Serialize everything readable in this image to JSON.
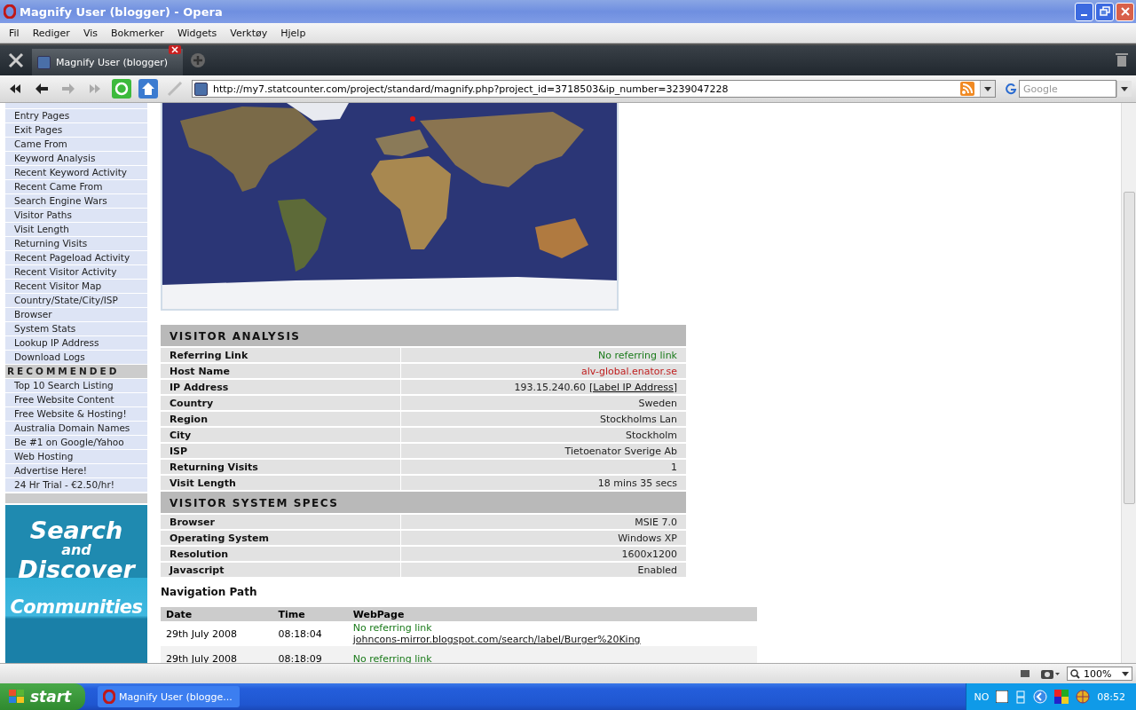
{
  "window": {
    "title": "Magnify User (blogger) - Opera"
  },
  "menu": [
    "Fil",
    "Rediger",
    "Vis",
    "Bokmerker",
    "Widgets",
    "Verktøy",
    "Hjelp"
  ],
  "tabs": [
    {
      "label": "Magnify User (blogger)",
      "selected": true
    }
  ],
  "address": {
    "url": "http://my7.statcounter.com/project/standard/magnify.php?project_id=3718503&ip_number=3239047228"
  },
  "search": {
    "placeholder": "Google"
  },
  "sidebar": {
    "items": [
      "Entry Pages",
      "Exit Pages",
      "Came From",
      "Keyword Analysis",
      "Recent Keyword Activity",
      "Recent Came From",
      "Search Engine Wars",
      "Visitor Paths",
      "Visit Length",
      "Returning Visits",
      "Recent Pageload Activity",
      "Recent Visitor Activity",
      "Recent Visitor Map",
      "Country/State/City/ISP",
      "Browser",
      "System Stats",
      "Lookup IP Address",
      "Download Logs"
    ],
    "section": "RECOMMENDED",
    "recommended": [
      "Top 10 Search Listing",
      "Free Website Content",
      "Free Website & Hosting!",
      "Australia Domain Names",
      "Be #1 on Google/Yahoo",
      "Web Hosting",
      "Advertise Here!",
      "24 Hr Trial - €2.50/hr!"
    ],
    "banner": {
      "line1": "Search",
      "line2": "and",
      "line3": "Discover",
      "line4": "Communities"
    }
  },
  "map": {
    "kind": "picture"
  },
  "sections": [
    {
      "title": "VISITOR ANALYSIS",
      "rows": [
        {
          "label": "Referring Link",
          "value": "No referring link",
          "kind": "referrer"
        },
        {
          "label": "Host Name",
          "value": "alv-global.enator.se",
          "kind": "host"
        },
        {
          "label": "IP Address",
          "value": "193.15.240.60",
          "link": "[Label IP Address]",
          "kind": "ip"
        },
        {
          "label": "Country",
          "value": "Sweden",
          "kind": "plain"
        },
        {
          "label": "Region",
          "value": "Stockholms Lan",
          "kind": "plain"
        },
        {
          "label": "City",
          "value": "Stockholm",
          "kind": "plain"
        },
        {
          "label": "ISP",
          "value": "Tietoenator Sverige Ab",
          "kind": "plain"
        },
        {
          "label": "Returning Visits",
          "value": "1",
          "kind": "plain"
        },
        {
          "label": "Visit Length",
          "value": "18 mins 35 secs",
          "kind": "plain"
        }
      ]
    },
    {
      "title": "VISITOR SYSTEM SPECS",
      "rows": [
        {
          "label": "Browser",
          "value": "MSIE 7.0",
          "kind": "plain"
        },
        {
          "label": "Operating System",
          "value": "Windows XP",
          "kind": "plain"
        },
        {
          "label": "Resolution",
          "value": "1600x1200",
          "kind": "plain"
        },
        {
          "label": "Javascript",
          "value": "Enabled",
          "kind": "plain"
        }
      ]
    }
  ],
  "navigation": {
    "title": "Navigation Path",
    "columns": [
      "Date",
      "Time",
      "WebPage"
    ],
    "rows": [
      {
        "date": "29th July 2008",
        "time": "08:18:04",
        "referrer": "No referring link",
        "page": "johncons-mirror.blogspot.com/search/label/Burger%20King"
      },
      {
        "date": "29th July 2008",
        "time": "08:18:09",
        "referrer": "No referring link"
      }
    ]
  },
  "status_bar": {
    "zoom": "100%"
  },
  "taskbar": {
    "start": "start",
    "task": "Magnify User (blogge...",
    "language": "NO",
    "clock": "08:52"
  }
}
